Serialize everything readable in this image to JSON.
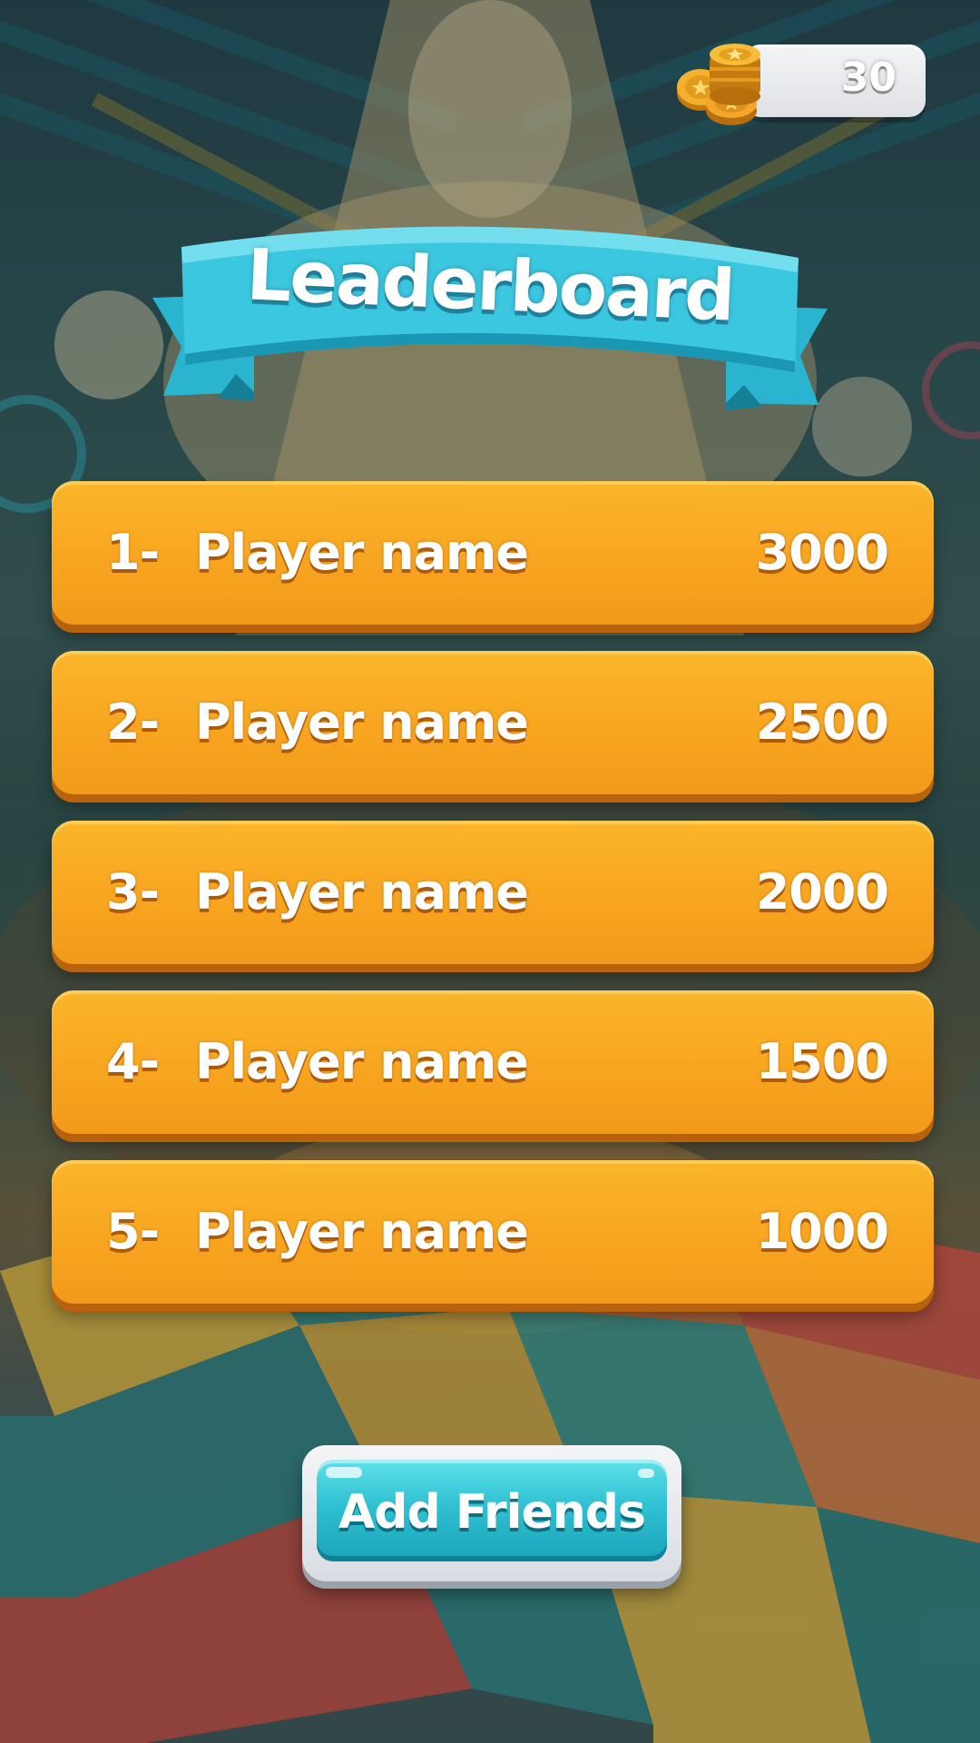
{
  "currency": {
    "coins": "30",
    "icon": "coin-stack-icon",
    "colors": {
      "coin": "#f2b631",
      "pill": "#e4e6e9"
    }
  },
  "title": {
    "text": "Leaderboard",
    "icon": "ribbon-banner",
    "color": "#38c3dc"
  },
  "leaderboard": {
    "row_color": "#f8a520",
    "entries": [
      {
        "rank": "1-",
        "name": "Player name",
        "score": "3000"
      },
      {
        "rank": "2-",
        "name": "Player name",
        "score": "2500"
      },
      {
        "rank": "3-",
        "name": "Player name",
        "score": "2000"
      },
      {
        "rank": "4-",
        "name": "Player name",
        "score": "1500"
      },
      {
        "rank": "5-",
        "name": "Player name",
        "score": "1000"
      }
    ]
  },
  "actions": {
    "add_friends_label": "Add Friends",
    "button_color": "#2fc1d2"
  }
}
